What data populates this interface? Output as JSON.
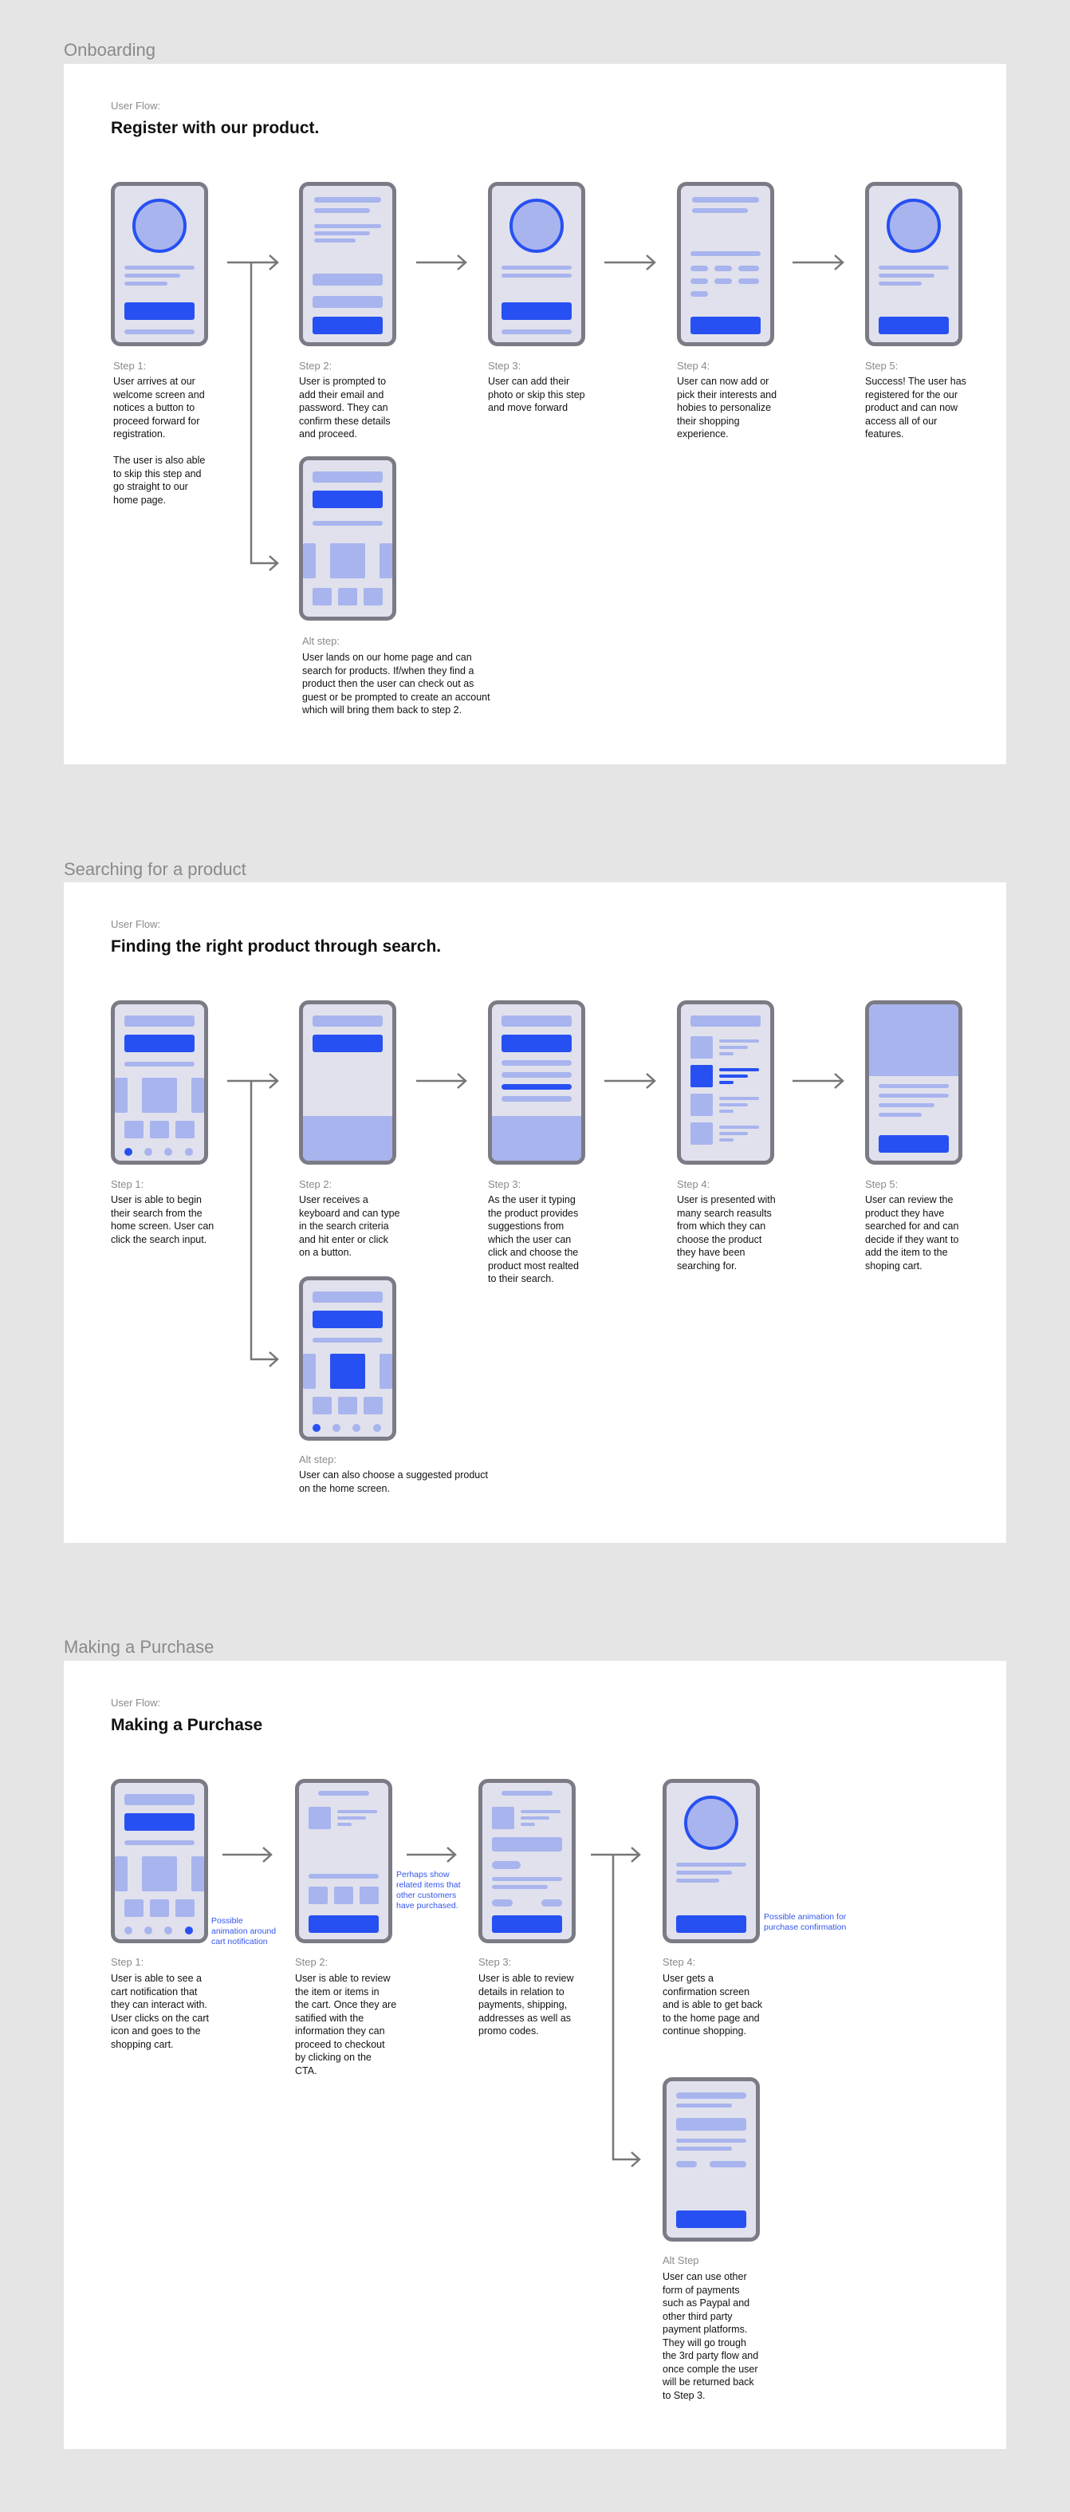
{
  "sections": [
    {
      "title": "Onboarding",
      "flow_label": "User Flow:",
      "flow_title": "Register with our product.",
      "steps": [
        {
          "label": "Step 1:",
          "desc": "User arrives at our\nwelcome screen and\nnotices a button to\nproceed forward for\nregistration.\n\nThe user is also able\nto skip this step and\ngo straight to our\nhome page."
        },
        {
          "label": "Step 2:",
          "desc": "User is prompted to\nadd their email and\npassword. They can\nconfirm these details\nand proceed."
        },
        {
          "label": "Step 3:",
          "desc": "User can add their\nphoto or skip this step\nand move forward"
        },
        {
          "label": "Step 4:",
          "desc": "User can now add or\npick their interests and\nhobies to personalize\ntheir shopping\nexperience."
        },
        {
          "label": "Step 5:",
          "desc": "Success! The user has\nregistered for the our\nproduct and can now\naccess all of our\nfeatures."
        }
      ],
      "alt": {
        "label": "Alt step:",
        "desc": "User lands on our home page and can\nsearch for products. If/when they find a\nproduct then the user can check out as\nguest or be prompted to create an account\nwhich will bring them back to step 2."
      }
    },
    {
      "title": "Searching for a product",
      "flow_label": "User Flow:",
      "flow_title": "Finding the right product through search.",
      "steps": [
        {
          "label": "Step 1:",
          "desc": "User is able to begin\ntheir search from the\nhome screen. User can\nclick the search input."
        },
        {
          "label": "Step 2:",
          "desc": "User receives a\nkeyboard and can type\nin the search criteria\nand hit enter or click\non a button."
        },
        {
          "label": "Step 3:",
          "desc": "As the user it typing\nthe product provides\nsuggestions from\nwhich the user can\nclick and choose the\nproduct most realted\nto their search."
        },
        {
          "label": "Step 4:",
          "desc": "User is presented with\nmany search reasults\nfrom which they can\nchoose the product\nthey have been\nsearching for."
        },
        {
          "label": "Step 5:",
          "desc": "User can review the\nproduct they have\nsearched for and can\ndecide if they want to\nadd the item to the\nshoping cart."
        }
      ],
      "alt": {
        "label": "Alt step:",
        "desc": "User can also choose a suggested product\non the home screen."
      }
    },
    {
      "title": "Making a Purchase",
      "flow_label": "User Flow:",
      "flow_title": "Making a Purchase",
      "steps": [
        {
          "label": "Step 1:",
          "desc": "User is able to see a\ncart notification that\nthey can interact with.\nUser clicks on the cart\nicon and goes to the\nshopping cart."
        },
        {
          "label": "Step 2:",
          "desc": "User is able to review\nthe item or items in\nthe cart. Once they are\nsatified with the\ninformation they can\nproceed to checkout\nby clicking on the\nCTA."
        },
        {
          "label": "Step 3:",
          "desc": "User is able to review\ndetails in relation to\npayments, shipping,\naddresses as well as\npromo codes."
        },
        {
          "label": "Step 4:",
          "desc": "User gets a\nconfirmation screen\nand is able to get back\nto the home page and\ncontinue shopping."
        }
      ],
      "alt": {
        "label": "Alt Step",
        "desc": "User can use other\nform of payments\nsuch as Paypal and\nother third party\npayment platforms.\nThey will go trough\nthe 3rd party flow and\nonce comple the user\nwill be returned back\nto Step 3."
      },
      "notes": [
        "Possible\nanimation around\ncart notification",
        "Perhaps show\nrelated items that\nother customers\nhave purchased.",
        "Possible animation for\npurchase confirmation"
      ]
    }
  ]
}
